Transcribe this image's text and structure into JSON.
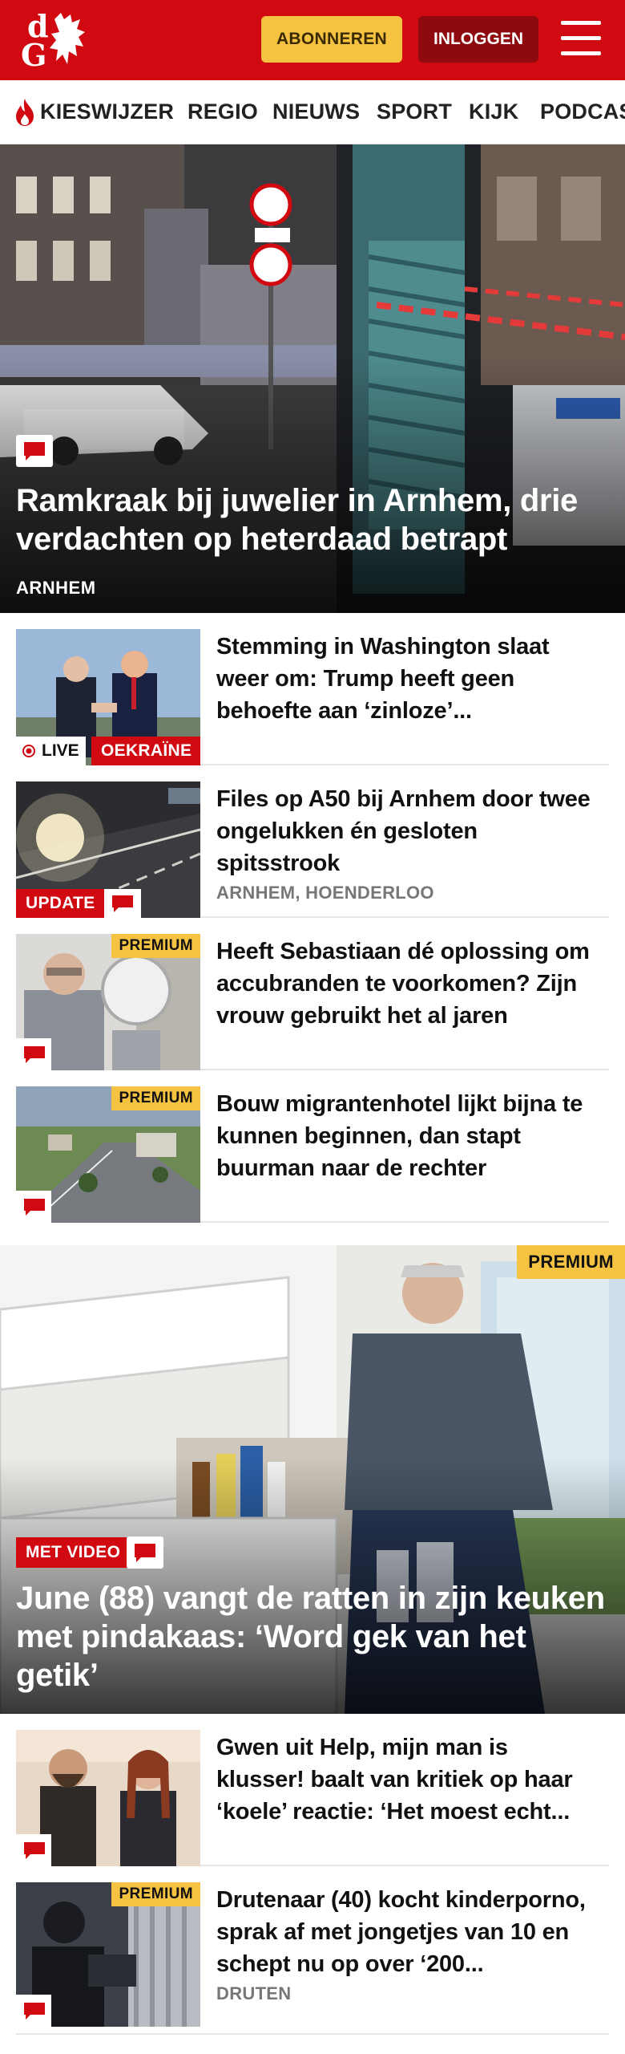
{
  "header": {
    "logo_text_d": "d",
    "logo_text_g": "G",
    "subscribe_label": "ABONNEREN",
    "login_label": "INLOGGEN"
  },
  "nav": {
    "items": [
      "KIESWIJZER",
      "REGIO",
      "NIEUWS",
      "SPORT",
      "KIJK",
      "PODCAST"
    ]
  },
  "hero": {
    "title": "Ramkraak bij juwelier in Arnhem, drie verdachten op heterdaad betrapt",
    "location": "ARNHEM"
  },
  "articles": [
    {
      "title": "Stemming in Washington slaat weer om: Trump heeft geen behoefte aan ‘zinloze’...",
      "live_label": "LIVE",
      "topic_label": "OEKRAÏNE"
    },
    {
      "title": "Files op A50 bij Arnhem door twee ongelukken én gesloten spitsstrook",
      "tag_label": "UPDATE",
      "location": "ARNHEM, HOENDERLOO"
    },
    {
      "title": "Heeft Sebastiaan dé oplossing om accubranden te voorkomen? Zijn vrouw gebruikt het al jaren",
      "premium_label": "PREMIUM"
    },
    {
      "title": "Bouw migrantenhotel lijkt bijna te kunnen beginnen, dan stapt buurman naar de rechter",
      "premium_label": "PREMIUM"
    }
  ],
  "hero2": {
    "title": "June (88) vangt de ratten in zijn keuken met pindakaas: ‘Word gek van het getik’",
    "tag_label": "MET VIDEO",
    "premium_label": "PREMIUM"
  },
  "articles2": [
    {
      "title": "Gwen uit Help, mijn man is klusser! baalt van kritiek op haar ‘koele’ reactie: ‘Het moest echt..."
    },
    {
      "title": "Drutenaar (40) kocht kinderporno, sprak af met jongetjes van 10 en schept nu op over ‘200...",
      "premium_label": "PREMIUM",
      "location": "DRUTEN"
    }
  ],
  "colors": {
    "brand_red": "#d10a11",
    "premium_yellow": "#f5c242",
    "login_dark_red": "#8f0a0f"
  },
  "icons": [
    "logo-dragon-icon",
    "menu-icon",
    "flame-icon",
    "comment-icon",
    "live-dot-icon"
  ]
}
